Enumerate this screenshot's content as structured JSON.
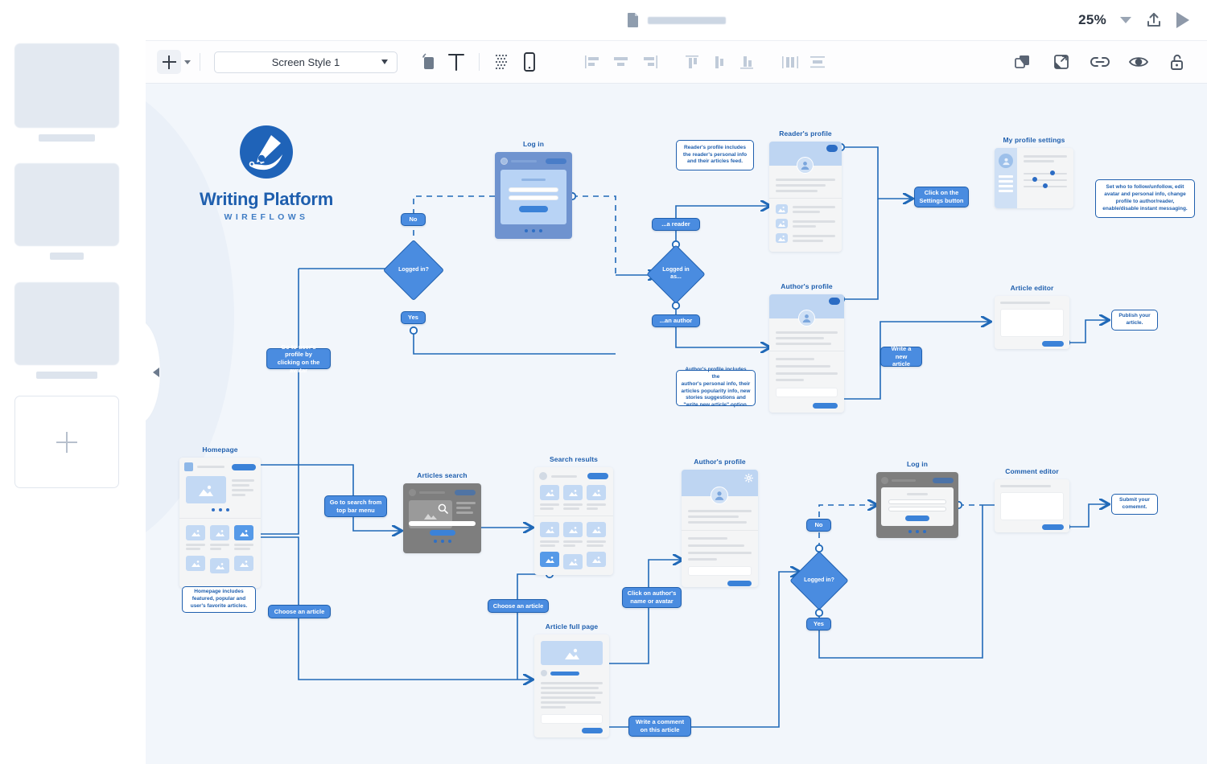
{
  "app": {
    "zoom_level": "25%",
    "topbar_icons": [
      "document-icon",
      "zoom-caret-icon",
      "share-upload-icon",
      "play-preview-icon"
    ],
    "title_placeholder": ""
  },
  "toolbar": {
    "add_label": "+",
    "style_select_value": "Screen Style 1",
    "style_select_options": [
      "Screen Style 1"
    ],
    "icons": [
      "add-element-icon",
      "add-caret-icon",
      "shape-rectangle-icon",
      "text-tool-icon",
      "divider-icon",
      "mask-pattern-icon",
      "device-phone-icon",
      "align-left-icon",
      "align-center-icon",
      "align-right-icon",
      "align-top-icon",
      "align-middle-icon",
      "align-bottom-icon",
      "distribute-horizontal-icon",
      "distribute-vertical-icon",
      "duplicate-icon",
      "resize-icon",
      "link-icon",
      "preview-eye-icon",
      "lock-icon"
    ]
  },
  "sidebar": {
    "thumbnails": [
      {
        "name": "screen-thumbnail-1"
      },
      {
        "name": "screen-thumbnail-2"
      },
      {
        "name": "screen-thumbnail-3"
      }
    ],
    "add_screen_label": "+",
    "collapse_icon": "collapse-left-icon"
  },
  "logo": {
    "title": "Writing Platform",
    "subtitle": "WIREFLOWS",
    "mark": "pen-nib-circle-icon"
  },
  "colors": {
    "accent_blue": "#4a8ce0",
    "deep_blue": "#1f5fae",
    "canvas_bg": "#f2f6fb",
    "screen_bg": "#f4f5f6",
    "header_blue": "#bed5f2",
    "overlay_blue": "#6f93cf",
    "overlay_gray": "#7e7e7e"
  },
  "flow": {
    "screens": [
      {
        "id": "login_top",
        "title": "Log in"
      },
      {
        "id": "readers_profile",
        "title": "Reader's profile"
      },
      {
        "id": "profile_settings",
        "title": "My profile settings"
      },
      {
        "id": "authors_profile",
        "title": "Author's profile"
      },
      {
        "id": "article_editor",
        "title": "Article editor"
      },
      {
        "id": "homepage",
        "title": "Homepage"
      },
      {
        "id": "articles_search",
        "title": "Articles search"
      },
      {
        "id": "search_results",
        "title": "Search results"
      },
      {
        "id": "authors_profile2",
        "title": "Author's profile"
      },
      {
        "id": "login_bottom",
        "title": "Log in"
      },
      {
        "id": "comment_editor",
        "title": "Comment editor"
      },
      {
        "id": "article_full",
        "title": "Article full page"
      }
    ],
    "decisions": [
      {
        "id": "logged_in_top",
        "text": "Logged in?"
      },
      {
        "id": "logged_in_as",
        "text": "Logged in\nas..."
      },
      {
        "id": "logged_in_bottom",
        "text": "Logged in?"
      }
    ],
    "edge_labels": [
      {
        "id": "no_top",
        "text": "No"
      },
      {
        "id": "yes_top",
        "text": "Yes"
      },
      {
        "id": "a_reader",
        "text": "...a reader"
      },
      {
        "id": "an_author",
        "text": "...an author"
      },
      {
        "id": "settings_btn",
        "text": "Click on the\nSettings button"
      },
      {
        "id": "write_new_article",
        "text": "Write a new\narticle"
      },
      {
        "id": "goto_profile",
        "text": "Go to user's profile by\nclicking on the avatar"
      },
      {
        "id": "goto_search",
        "text": "Go to search from\ntop bar menu"
      },
      {
        "id": "choose_article_1",
        "text": "Choose an article"
      },
      {
        "id": "choose_article_2",
        "text": "Choose an article"
      },
      {
        "id": "click_author",
        "text": "Click on author's\nname or avatar"
      },
      {
        "id": "write_comment",
        "text": "Write a comment\non this article"
      },
      {
        "id": "no_bottom",
        "text": "No"
      },
      {
        "id": "yes_bottom",
        "text": "Yes"
      }
    ],
    "notes": [
      {
        "id": "note_reader",
        "text": "Reader's profile includes\nthe reader's personal info\nand their articles feed."
      },
      {
        "id": "note_settings",
        "text": "Set who to follow/unfollow, edit\navatar and personal info, change\nprofile to author/reader,\nenable/disable instant messaging."
      },
      {
        "id": "note_author",
        "text": "Author's profile includes the\nauthor's personal info, their\narticles popularity info, new\nstories suggestions and\n\"write new article\" option."
      },
      {
        "id": "note_publish",
        "text": "Publish your\narticle."
      },
      {
        "id": "note_homepage",
        "text": "Homepage includes\nfeatured, popular and\nuser's favorite articles."
      },
      {
        "id": "note_submit",
        "text": "Submit your\ncomemnt."
      }
    ]
  }
}
